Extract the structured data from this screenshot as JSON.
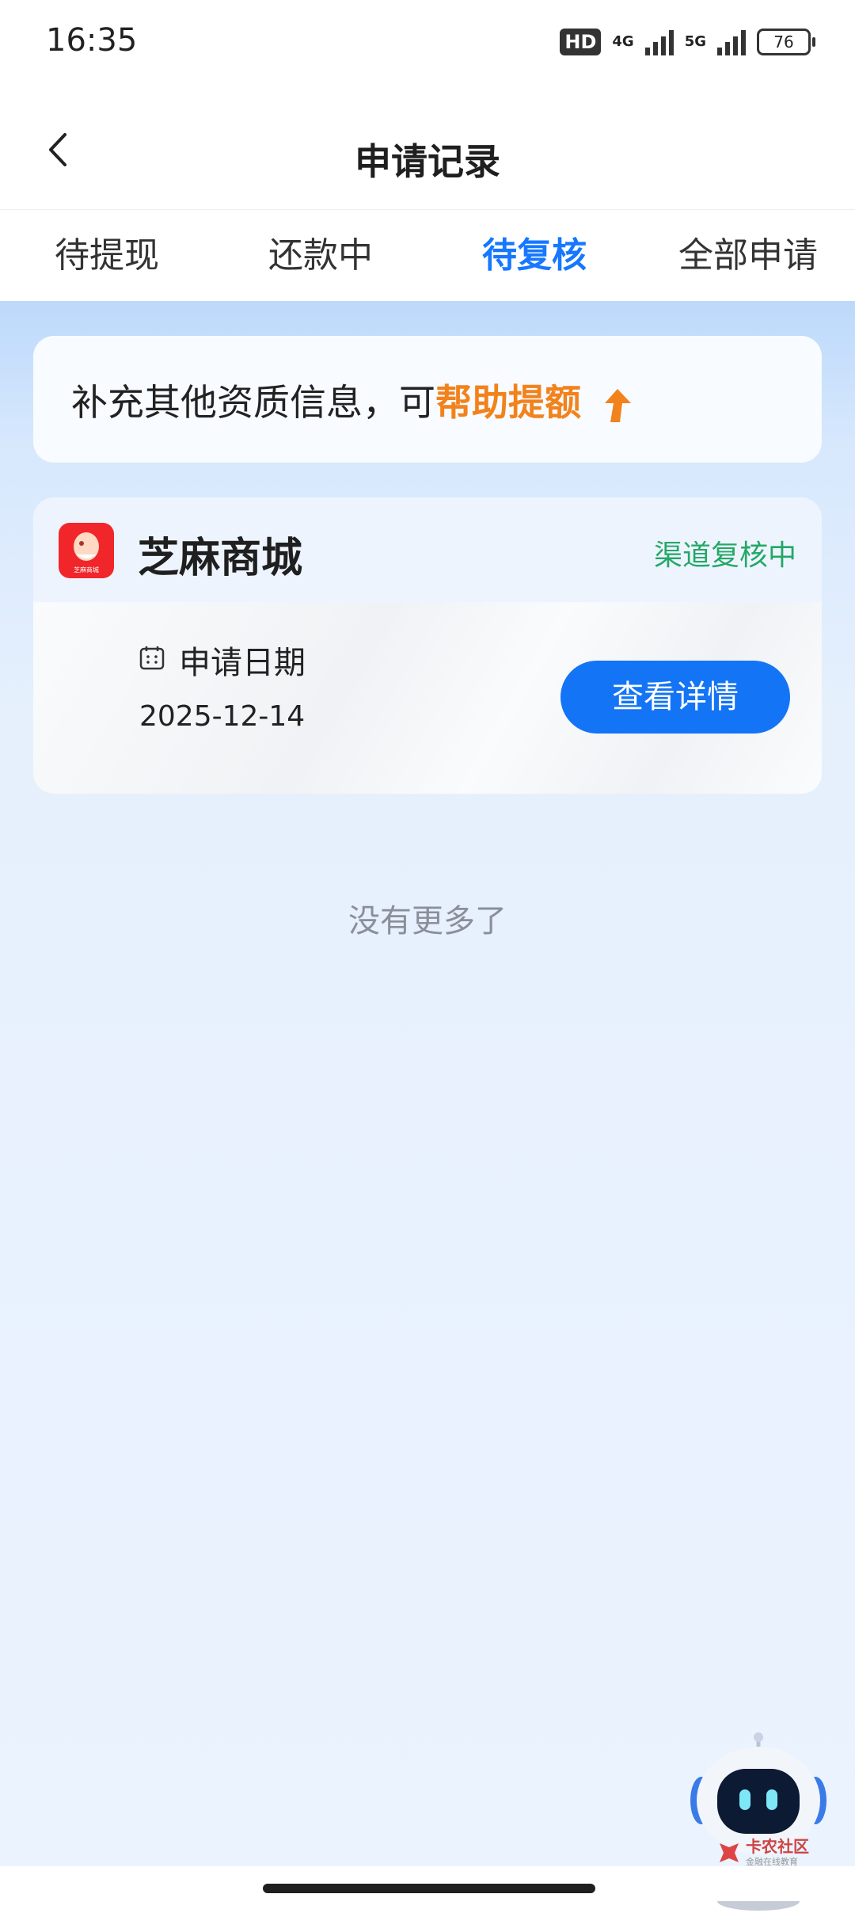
{
  "status_bar": {
    "time": "16:35",
    "hd": "HD",
    "net1": "4G",
    "net2": "5G",
    "battery": "76"
  },
  "header": {
    "title": "申请记录"
  },
  "tabs": [
    {
      "label": "待提现"
    },
    {
      "label": "还款中"
    },
    {
      "label": "待复核",
      "active": true
    },
    {
      "label": "全部申请"
    }
  ],
  "banner": {
    "text": "补充其他资质信息，可",
    "highlight": "帮助提额"
  },
  "card": {
    "merchant": "芝麻商城",
    "logo_text": "芝麻商城",
    "status": "渠道复核中",
    "date_label": "申请日期",
    "date_value": "2025-12-14",
    "detail_button": "查看详情"
  },
  "footer": {
    "no_more": "没有更多了"
  },
  "watermark": {
    "title": "卡农社区",
    "subtitle": "金融在线教育"
  },
  "colors": {
    "accent": "#1677ff",
    "highlight": "#f2821c",
    "status": "#23a867",
    "logo": "#f1262a"
  }
}
